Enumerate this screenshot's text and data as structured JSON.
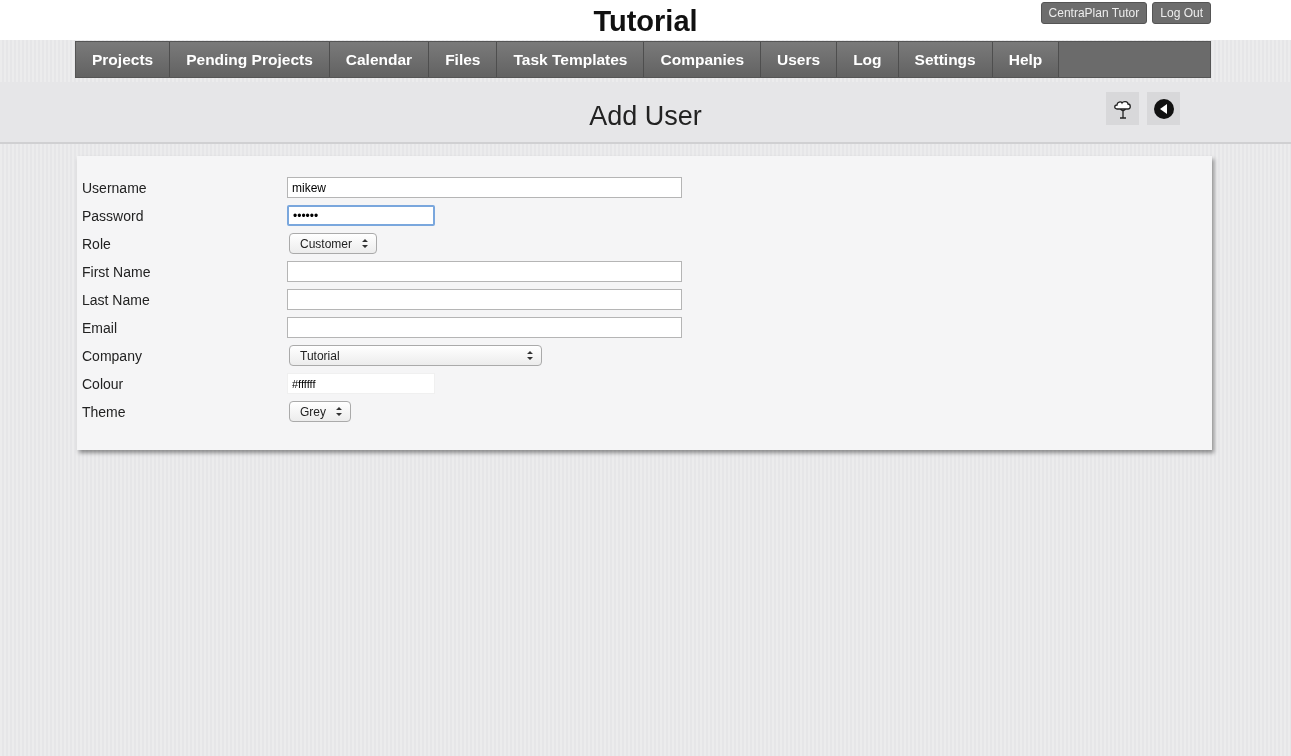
{
  "header": {
    "title": "Tutorial",
    "account_buttons": [
      "CentraPlan Tutor",
      "Log Out"
    ]
  },
  "nav": [
    {
      "label": "Projects"
    },
    {
      "label": "Pending Projects"
    },
    {
      "label": "Calendar"
    },
    {
      "label": "Files"
    },
    {
      "label": "Task Templates"
    },
    {
      "label": "Companies"
    },
    {
      "label": "Users"
    },
    {
      "label": "Log"
    },
    {
      "label": "Settings"
    },
    {
      "label": "Help"
    }
  ],
  "page": {
    "title": "Add User"
  },
  "form": [
    {
      "label": "Username",
      "kind": "text",
      "value": "mikew",
      "focused": false
    },
    {
      "label": "Password",
      "kind": "password",
      "value": "••••••",
      "focused": true
    },
    {
      "label": "Role",
      "kind": "select",
      "value": "Customer",
      "focused": false
    },
    {
      "label": "First Name",
      "kind": "text",
      "focused": false
    },
    {
      "label": "Last Name",
      "kind": "text",
      "focused": false
    },
    {
      "label": "Email",
      "kind": "text",
      "focused": false
    },
    {
      "label": "Company",
      "kind": "wide-select",
      "value": "Tutorial",
      "focused": false
    },
    {
      "label": "Colour",
      "kind": "colour",
      "value": "#ffffff",
      "focused": false
    },
    {
      "label": "Theme",
      "kind": "select",
      "value": "Grey",
      "focused": false
    }
  ]
}
